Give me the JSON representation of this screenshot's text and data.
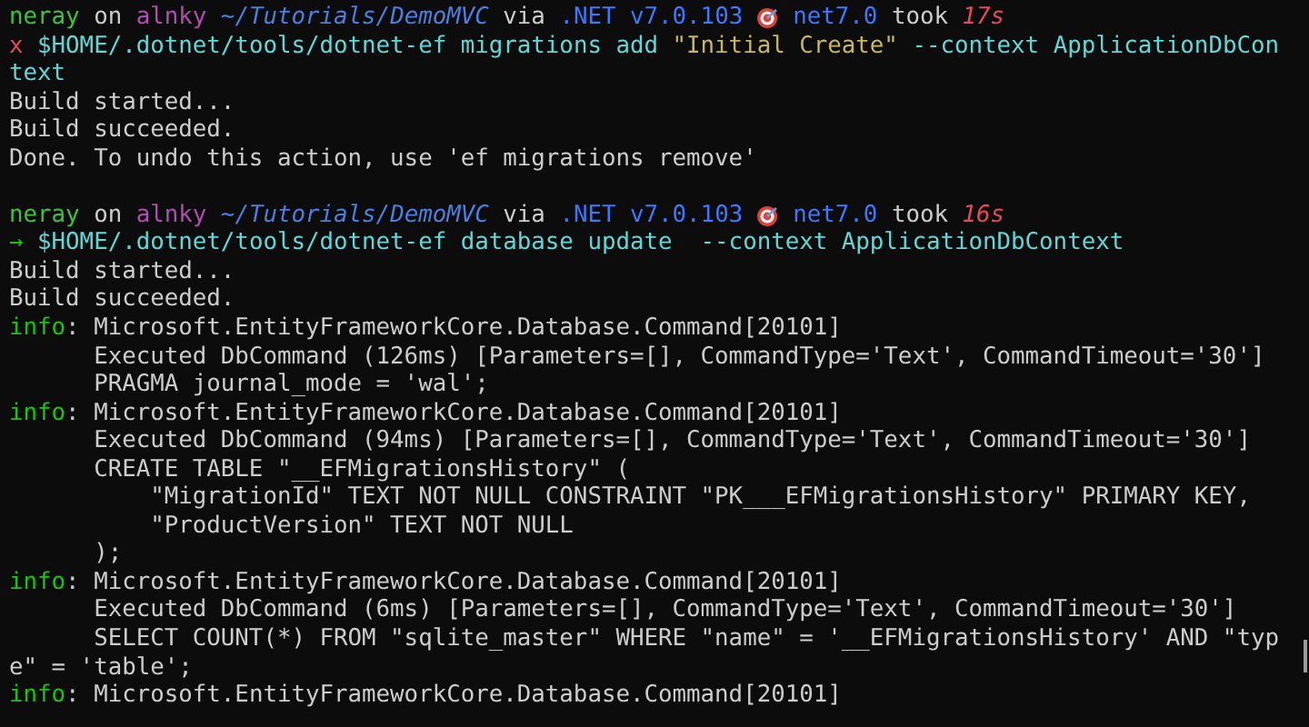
{
  "terminal": {
    "lines": [
      {
        "kind": "text",
        "segments": [
          {
            "kind": "user",
            "text": "neray"
          },
          {
            "kind": "plain",
            "text": " on "
          },
          {
            "kind": "host",
            "text": "alnky"
          },
          {
            "kind": "path",
            "text": " ~/Tutorials/DemoMVC"
          },
          {
            "kind": "plain",
            "text": " via "
          },
          {
            "kind": "runtime",
            "text": ".NET v7.0.103 "
          },
          {
            "kind": "icon"
          },
          {
            "kind": "runtime",
            "text": " net7.0"
          },
          {
            "kind": "plain",
            "text": " took "
          },
          {
            "kind": "duration",
            "text": "17s"
          }
        ]
      },
      {
        "kind": "text",
        "segments": [
          {
            "kind": "error",
            "text": "x"
          },
          {
            "kind": "command",
            "text": " $HOME/.dotnet/tools/dotnet-ef migrations add "
          },
          {
            "kind": "string",
            "text": "\"Initial Create\""
          },
          {
            "kind": "command",
            "text": " --context ApplicationDbCon"
          }
        ]
      },
      {
        "kind": "text",
        "segments": [
          {
            "kind": "command",
            "text": "text"
          }
        ]
      },
      {
        "kind": "text",
        "segments": [
          {
            "kind": "plain",
            "text": "Build started..."
          }
        ]
      },
      {
        "kind": "text",
        "segments": [
          {
            "kind": "plain",
            "text": "Build succeeded."
          }
        ]
      },
      {
        "kind": "text",
        "segments": [
          {
            "kind": "plain",
            "text": "Done. To undo this action, use 'ef migrations remove'"
          }
        ]
      },
      {
        "kind": "blank"
      },
      {
        "kind": "text",
        "segments": [
          {
            "kind": "user",
            "text": "neray"
          },
          {
            "kind": "plain",
            "text": " on "
          },
          {
            "kind": "host",
            "text": "alnky"
          },
          {
            "kind": "path",
            "text": " ~/Tutorials/DemoMVC"
          },
          {
            "kind": "plain",
            "text": " via "
          },
          {
            "kind": "runtime",
            "text": ".NET v7.0.103 "
          },
          {
            "kind": "icon"
          },
          {
            "kind": "runtime",
            "text": " net7.0"
          },
          {
            "kind": "plain",
            "text": " took "
          },
          {
            "kind": "duration",
            "text": "16s"
          }
        ]
      },
      {
        "kind": "text",
        "segments": [
          {
            "kind": "success",
            "text": "→"
          },
          {
            "kind": "command",
            "text": " $HOME/.dotnet/tools/dotnet-ef database update  --context ApplicationDbContext"
          }
        ]
      },
      {
        "kind": "text",
        "segments": [
          {
            "kind": "plain",
            "text": "Build started..."
          }
        ]
      },
      {
        "kind": "text",
        "segments": [
          {
            "kind": "plain",
            "text": "Build succeeded."
          }
        ]
      },
      {
        "kind": "text",
        "segments": [
          {
            "kind": "info",
            "text": "info"
          },
          {
            "kind": "plain",
            "text": ": Microsoft.EntityFrameworkCore.Database.Command[20101]"
          }
        ]
      },
      {
        "kind": "text",
        "segments": [
          {
            "kind": "plain",
            "text": "      Executed DbCommand (126ms) [Parameters=[], CommandType='Text', CommandTimeout='30']"
          }
        ]
      },
      {
        "kind": "text",
        "segments": [
          {
            "kind": "plain",
            "text": "      PRAGMA journal_mode = 'wal';"
          }
        ]
      },
      {
        "kind": "text",
        "segments": [
          {
            "kind": "info",
            "text": "info"
          },
          {
            "kind": "plain",
            "text": ": Microsoft.EntityFrameworkCore.Database.Command[20101]"
          }
        ]
      },
      {
        "kind": "text",
        "segments": [
          {
            "kind": "plain",
            "text": "      Executed DbCommand (94ms) [Parameters=[], CommandType='Text', CommandTimeout='30']"
          }
        ]
      },
      {
        "kind": "text",
        "segments": [
          {
            "kind": "plain",
            "text": "      CREATE TABLE \"__EFMigrationsHistory\" ("
          }
        ]
      },
      {
        "kind": "text",
        "segments": [
          {
            "kind": "plain",
            "text": "          \"MigrationId\" TEXT NOT NULL CONSTRAINT \"PK___EFMigrationsHistory\" PRIMARY KEY,"
          }
        ]
      },
      {
        "kind": "text",
        "segments": [
          {
            "kind": "plain",
            "text": "          \"ProductVersion\" TEXT NOT NULL"
          }
        ]
      },
      {
        "kind": "text",
        "segments": [
          {
            "kind": "plain",
            "text": "      );"
          }
        ]
      },
      {
        "kind": "text",
        "segments": [
          {
            "kind": "info",
            "text": "info"
          },
          {
            "kind": "plain",
            "text": ": Microsoft.EntityFrameworkCore.Database.Command[20101]"
          }
        ]
      },
      {
        "kind": "text",
        "segments": [
          {
            "kind": "plain",
            "text": "      Executed DbCommand (6ms) [Parameters=[], CommandType='Text', CommandTimeout='30']"
          }
        ]
      },
      {
        "kind": "text",
        "segments": [
          {
            "kind": "plain",
            "text": "      SELECT COUNT(*) FROM \"sqlite_master\" WHERE \"name\" = '__EFMigrationsHistory' AND \"typ"
          }
        ]
      },
      {
        "kind": "text",
        "segments": [
          {
            "kind": "plain",
            "text": "e\" = 'table';"
          }
        ]
      },
      {
        "kind": "text",
        "segments": [
          {
            "kind": "info",
            "text": "info"
          },
          {
            "kind": "plain",
            "text": ": Microsoft.EntityFrameworkCore.Database.Command[20101]"
          }
        ]
      }
    ]
  }
}
